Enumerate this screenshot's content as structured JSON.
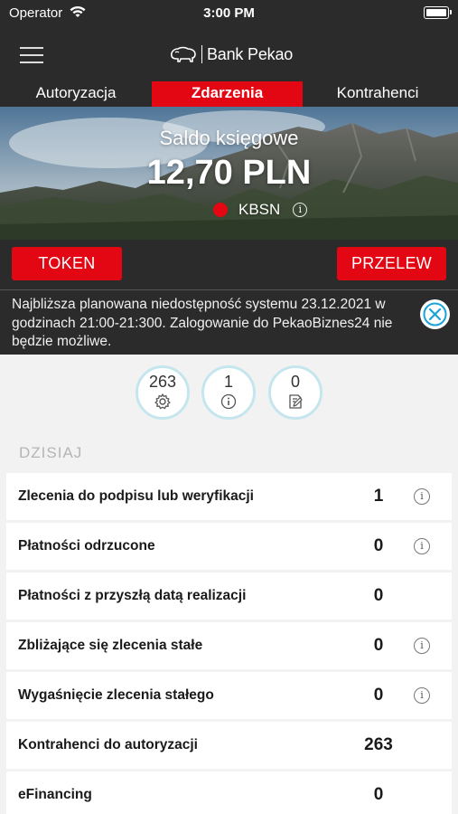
{
  "status_bar": {
    "carrier": "Operator",
    "time": "3:00 PM"
  },
  "header": {
    "logo_text": "Bank Pekao"
  },
  "tabs": [
    {
      "label": "Autoryzacja"
    },
    {
      "label": "Zdarzenia",
      "active": true
    },
    {
      "label": "Kontrahenci"
    }
  ],
  "hero": {
    "balance_label": "Saldo księgowe",
    "balance_value": "12,70 PLN",
    "account_name": "KBSN",
    "info_icon": "info-icon"
  },
  "actions": {
    "token_label": "TOKEN",
    "przelew_label": "PRZELEW"
  },
  "notice": {
    "text": "Najbliższa planowana niedostępność systemu 23.12.2021 w godzinach 21:00-21:300. Zalogowanie do PekaoBiznes24 nie będzie możliwe."
  },
  "counters": [
    {
      "value": "263",
      "icon": "gear-icon"
    },
    {
      "value": "1",
      "icon": "info-icon"
    },
    {
      "value": "0",
      "icon": "document-edit-icon"
    }
  ],
  "section_title": "DZISIAJ",
  "rows": [
    {
      "label": "Zlecenia do podpisu lub weryfikacji",
      "value": "1",
      "info": true
    },
    {
      "label": "Płatności odrzucone",
      "value": "0",
      "info": true
    },
    {
      "label": "Płatności z przyszłą datą realizacji",
      "value": "0",
      "info": false
    },
    {
      "label": "Zbliżające się zlecenia stałe",
      "value": "0",
      "info": true
    },
    {
      "label": "Wygaśnięcie zlecenia stałego",
      "value": "0",
      "info": true
    },
    {
      "label": "Kontrahenci do autoryzacji",
      "value": "263",
      "info": false
    },
    {
      "label": "eFinancing",
      "value": "0",
      "info": false
    }
  ],
  "colors": {
    "brand_red": "#e30613",
    "dark_bg": "#2b2b2b",
    "counter_ring": "#c5e6ee",
    "close_blue": "#1aa3d8"
  }
}
